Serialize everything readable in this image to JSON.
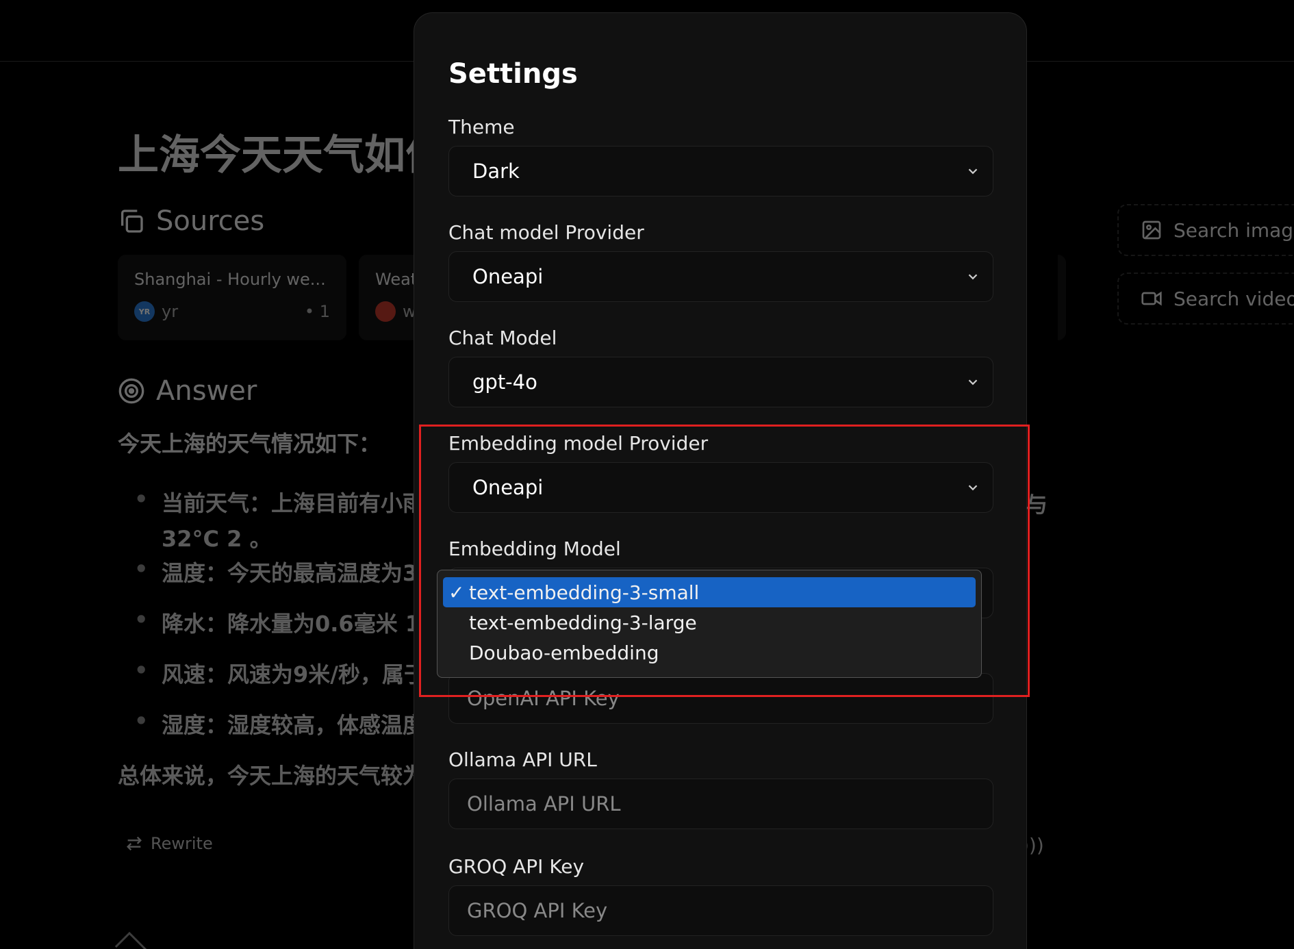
{
  "background": {
    "question_title": "上海今天天气如何",
    "sources": {
      "heading": "Sources",
      "cards": [
        {
          "title": "Shanghai - Hourly we...",
          "site": "yr",
          "site_badge": "YR",
          "index": "1"
        },
        {
          "title": "Weat",
          "site": "w"
        }
      ]
    },
    "answer": {
      "heading": "Answer",
      "lead": "今天上海的天气情况如下：",
      "bullets": [
        "当前天气：上海目前有小雨",
        "温度：今天的最高温度为3",
        "降水：降水量为0.6毫米  1",
        "风速：风速为9米/秒，属于",
        "湿度：湿度较高，体感温度"
      ],
      "bullet_continuation": "32°C  2 。",
      "stray_char": "与",
      "summary": "总体来说，今天上海的天气较为",
      "rewrite_label": "Rewrite"
    },
    "side_buttons": {
      "search_images": "Search images",
      "search_videos": "Search videos"
    }
  },
  "settings": {
    "title": "Settings",
    "theme": {
      "label": "Theme",
      "value": "Dark"
    },
    "chat_provider": {
      "label": "Chat model Provider",
      "value": "Oneapi"
    },
    "chat_model": {
      "label": "Chat Model",
      "value": "gpt-4o"
    },
    "embedding_provider": {
      "label": "Embedding model Provider",
      "value": "Oneapi"
    },
    "embedding_model": {
      "label": "Embedding Model",
      "options": [
        "text-embedding-3-small",
        "text-embedding-3-large",
        "Doubao-embedding"
      ],
      "selected": "text-embedding-3-small"
    },
    "openai_key": {
      "placeholder": "OpenAI API Key"
    },
    "ollama_url": {
      "label": "Ollama API URL",
      "placeholder": "Ollama API URL"
    },
    "groq_key": {
      "label": "GROQ API Key",
      "placeholder": "GROQ API Key"
    }
  },
  "colors": {
    "selected_option": "#1763c4",
    "highlight_border": "#e02020",
    "modal_bg": "#111111"
  }
}
